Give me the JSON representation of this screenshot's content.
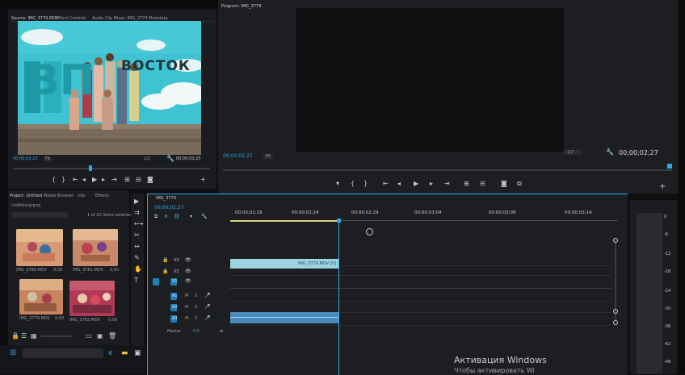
{
  "source_monitor": {
    "tabs": [
      "Source: IMG_3779.MOV",
      "Effect Controls",
      "Audio Clip Mixer: IMG_3779",
      "Metadata"
    ],
    "timecode_left": "00;00;03;23",
    "fit_label": "Fit",
    "zoom_label": "1/2",
    "timecode_right": "00;00;03;25",
    "sign_text": "ВОСТОК",
    "letters_text": "ВП"
  },
  "program_monitor": {
    "title": "Program: IMG_3779",
    "timecode_left": "00;00;02;27",
    "fit_label": "Fit",
    "zoom_label": "1/2",
    "timecode_right": "00;00;02;27"
  },
  "project_panel": {
    "tabs": [
      "Project: Untitled",
      "Media Browser",
      "Info",
      "Effects"
    ],
    "bin_name": "Untitled.prproj",
    "search_placeholder": "",
    "items_selected": "1 of 22 items selected",
    "items": [
      {
        "name": "IMG_3780.MOV",
        "duration": "0;00"
      },
      {
        "name": "IMG_3781.MOV",
        "duration": "0;00"
      },
      {
        "name": "IMG_3779.MOV",
        "duration": "0;00"
      },
      {
        "name": "IMG_3782.MOV",
        "duration": "0;00"
      }
    ]
  },
  "timeline": {
    "tab": "IMG_3779",
    "timecode": "00;00;02;27",
    "ruler": [
      "00;00;02;19",
      "00;00;02;24",
      "00;00;02;29",
      "00;00;03;04",
      "00;00;03;09",
      "00;00;03;14"
    ],
    "video_tracks": [
      "V3",
      "V2",
      "V1"
    ],
    "audio_tracks": [
      "A1",
      "A2",
      "A3"
    ],
    "master_label": "Master",
    "master_value": "0.0",
    "clip_label": "IMG_3779.MOV [V]"
  },
  "audio_meter": {
    "scale": [
      "0",
      "-6",
      "-12",
      "-18",
      "-24",
      "-30",
      "-36",
      "-42",
      "-48"
    ]
  },
  "watermark": {
    "line1": "Активация Windows",
    "line2": "Чтобы активировать Wi"
  },
  "colors": {
    "accent": "#2da8e8",
    "clip_video": "#9bd4de",
    "clip_audio": "#4a8bbd"
  }
}
